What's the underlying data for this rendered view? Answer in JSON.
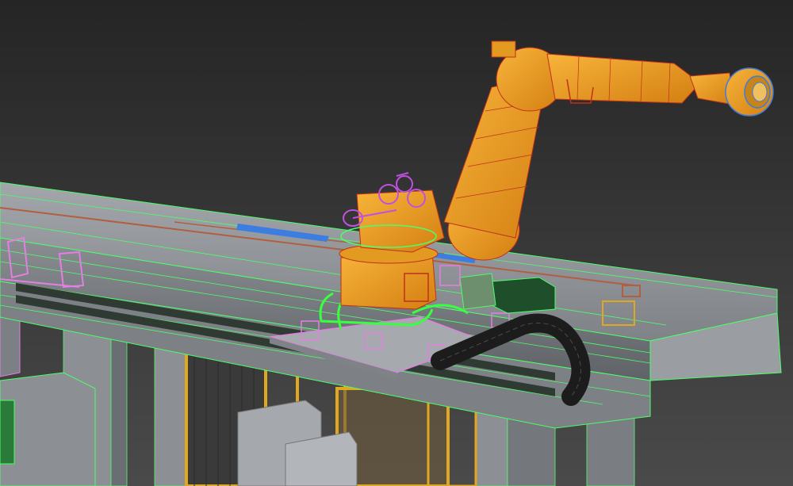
{
  "scene": {
    "kind": "3d-viewport-wireframe-render",
    "background_top": "#252525",
    "background_bottom": "#4a4a4a",
    "colors": {
      "robot_orange": "#f0a020",
      "robot_orange_dark": "#c07010",
      "robot_edges": "#c0301a",
      "rail_gray": "#8d9095",
      "rail_gray_dark": "#6b6e73",
      "rail_edges": "#4cff6a",
      "cable_green": "#38ff40",
      "gripper_purple": "#c050e0",
      "pink_parts": "#e080e0",
      "blue_bar": "#3b7de0",
      "cable_chain": "#1c1c1c",
      "fence_yellow": "#e0a820",
      "motor_green": "#1f4f2a"
    },
    "objects": [
      "linear-rail-track",
      "industrial-robot-arm",
      "robot-base-turntable",
      "end-effector-flange",
      "cable-carrier-chain",
      "drive-motor",
      "slide-carriage",
      "safety-fence",
      "support-columns",
      "control-cabinet"
    ]
  }
}
